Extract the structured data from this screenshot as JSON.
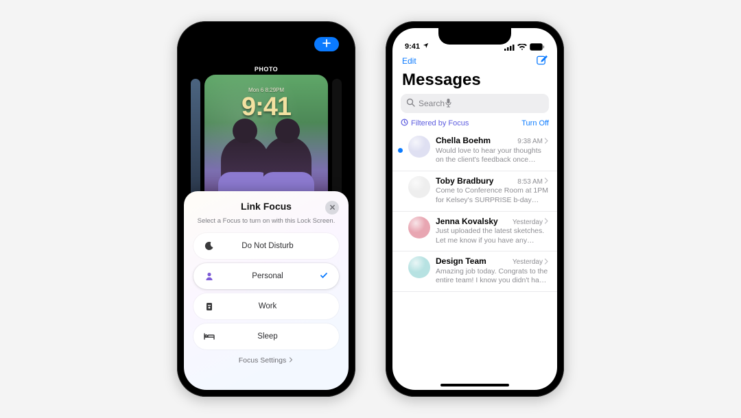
{
  "left": {
    "wallpaper_label": "PHOTO",
    "clock_small": "Mon 6  8:29PM",
    "clock_big": "9:41",
    "sheet": {
      "title": "Link Focus",
      "subtitle": "Select a Focus to turn on with this Lock Screen.",
      "items": [
        {
          "id": "dnd",
          "label": "Do Not Disturb",
          "icon": "moon",
          "selected": false
        },
        {
          "id": "personal",
          "label": "Personal",
          "icon": "person",
          "selected": true
        },
        {
          "id": "work",
          "label": "Work",
          "icon": "badge",
          "selected": false
        },
        {
          "id": "sleep",
          "label": "Sleep",
          "icon": "bed",
          "selected": false
        }
      ],
      "footer": "Focus Settings"
    }
  },
  "right": {
    "status_time": "9:41",
    "edit": "Edit",
    "title": "Messages",
    "search_placeholder": "Search",
    "filter_label": "Filtered by Focus",
    "filter_action": "Turn Off",
    "conversations": [
      {
        "name": "Chella Boehm",
        "time": "9:38 AM",
        "unread": true,
        "avatar_color": "#dfe0f2",
        "preview": "Would love to hear your thoughts on the client's feedback once you've finished th…"
      },
      {
        "name": "Toby Bradbury",
        "time": "8:53 AM",
        "unread": false,
        "avatar_color": "#eeeeee",
        "preview": "Come to Conference Room at 1PM for Kelsey's SURPRISE b-day celebration."
      },
      {
        "name": "Jenna Kovalsky",
        "time": "Yesterday",
        "unread": false,
        "avatar_color": "#e8a6b2",
        "preview": "Just uploaded the latest sketches. Let me know if you have any issues accessing."
      },
      {
        "name": "Design Team",
        "time": "Yesterday",
        "unread": false,
        "avatar_color": "#b7e2e2",
        "preview": "Amazing job today. Congrats to the entire team! I know you didn't have a lot of tim…"
      }
    ]
  }
}
